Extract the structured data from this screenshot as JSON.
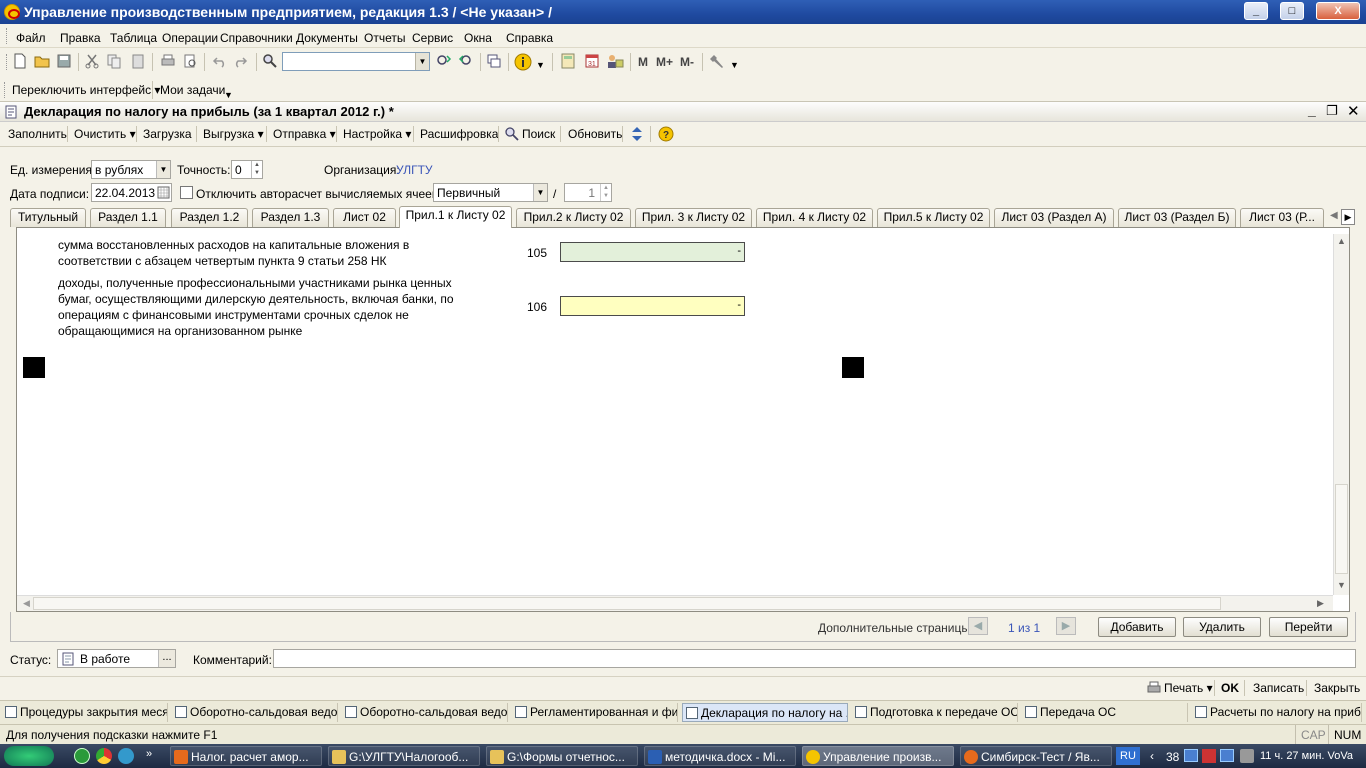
{
  "app": {
    "title": "Управление производственным предприятием, редакция 1.3 / <Не указан> /",
    "window_buttons": [
      "_",
      "□",
      "X"
    ]
  },
  "menu": [
    "Файл",
    "Правка",
    "Таблица",
    "Операции",
    "Справочники",
    "Документы",
    "Отчеты",
    "Сервис",
    "Окна",
    "Справка"
  ],
  "toolbar": {
    "search_placeholder": "",
    "m_buttons": [
      "M",
      "M+",
      "M-"
    ]
  },
  "panel": {
    "switch_interface": "Переключить интерфейс ▾",
    "my_tasks": "Мои задачи"
  },
  "document": {
    "title": "Декларация по налогу на прибыль (за 1 квартал 2012 г.) *",
    "toolbar": {
      "fill": "Заполнить",
      "clear": "Очистить ▾",
      "load": "Загрузка",
      "export": "Выгрузка ▾",
      "send": "Отправка ▾",
      "settings": "Настройка ▾",
      "decode": "Расшифровка",
      "search": "Поиск",
      "refresh": "Обновить"
    },
    "header": {
      "units_label": "Ед. измерения:",
      "units_value": "в рублях",
      "precision_label": "Точность:",
      "precision_value": "0",
      "org_label": "Организация:",
      "org_value": "УЛГТУ",
      "sign_date_label": "Дата подписи:",
      "sign_date_value": "22.04.2013",
      "autocalc_label": "Отключить авторасчет вычисляемых ячеек",
      "type_value": "Первичный",
      "slash": "/",
      "corr_number": "1"
    },
    "tabs": [
      "Титульный",
      "Раздел 1.1",
      "Раздел 1.2",
      "Раздел 1.3",
      "Лист 02",
      "Прил.1 к Листу 02",
      "Прил.2 к Листу 02",
      "Прил. 3 к Листу 02",
      "Прил. 4 к Листу 02",
      "Прил.5 к Листу 02",
      "Лист 03 (Раздел А)",
      "Лист 03 (Раздел Б)",
      "Лист 03 (Р..."
    ],
    "rows": [
      {
        "lines": [
          "сумма восстановленных расходов на капитальные вложения в",
          "соответствии с абзацем четвертым пункта 9 статьи 258 НК"
        ],
        "code": "105",
        "value": "-",
        "color": "#e3f0da"
      },
      {
        "lines": [
          "доходы, полученные профессиональными участниками рынка ценных",
          "бумаг, осуществляющими дилерскую деятельность, включая банки, по",
          "операциям с финансовыми инструментами срочных сделок не",
          "обращающимися на организованном рынке"
        ],
        "code": "106",
        "value": "-",
        "color": "#ffffc0"
      }
    ],
    "extra_pages": {
      "label": "Дополнительные страницы:",
      "counter": "1 из 1",
      "add": "Добавить",
      "delete": "Удалить",
      "goto": "Перейти"
    },
    "status_label": "Статус:",
    "status_value": "В работе",
    "comment_label": "Комментарий:",
    "comment_value": "",
    "print": "Печать ▾",
    "ok": "OK",
    "save": "Записать",
    "close": "Закрыть"
  },
  "window_tabs": [
    "Процедуры закрытия меся...",
    "Оборотно-сальдовая ведо...",
    "Оборотно-сальдовая ведо...",
    "Регламентированная и фи...",
    "Декларация по налогу на ...",
    "Подготовка к передаче ОС",
    "Передача ОС",
    "Расчеты по налогу на приб..."
  ],
  "statusbar": {
    "hint": "Для получения подсказки нажмите F1",
    "cap": "CAP",
    "num": "NUM"
  },
  "taskbar": {
    "items": [
      "Налог. расчет амор...",
      "G:\\УЛГТУ\\Налогооб...",
      "G:\\Формы отчетнос...",
      "методичка.docx - Mi...",
      "Управление произв...",
      "Симбирск-Тест / Яв..."
    ],
    "lang": "RU",
    "count": "38",
    "clock": "11 ч. 27 мин. VoVa"
  }
}
